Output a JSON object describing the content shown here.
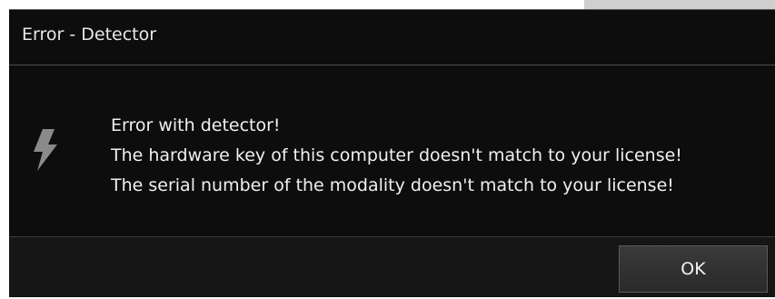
{
  "dialog": {
    "title": "Error - Detector",
    "icon": "lightning-bolt-icon",
    "messages": [
      "Error with detector!",
      "The hardware key of this computer doesn't match to your license!",
      "The serial number of the modality doesn't match to your license!"
    ],
    "ok_label": "OK"
  },
  "colors": {
    "background": "#0d0d0d",
    "text": "#f0f0f0",
    "icon": "#8a8a8a",
    "button": "#333333"
  }
}
